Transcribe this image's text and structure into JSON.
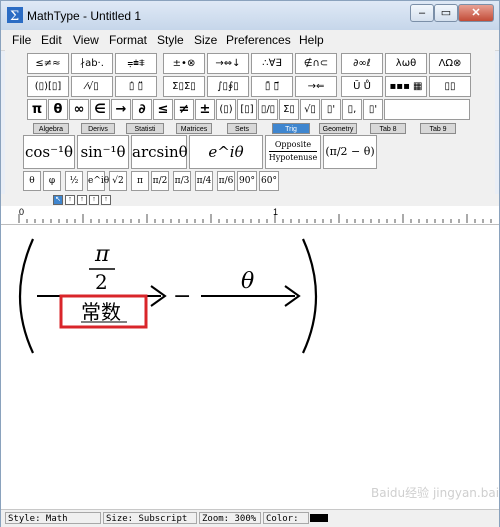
{
  "window": {
    "title": "MathType - Untitled 1",
    "min": "–",
    "max": "▭",
    "close": "✕"
  },
  "menu": [
    "File",
    "Edit",
    "View",
    "Format",
    "Style",
    "Size",
    "Preferences",
    "Help"
  ],
  "palette_row1": [
    "≤≠≈",
    "∤ab·.",
    "⩦⩧⩨",
    "±•⊗",
    "→⇔↓",
    "∴∀∃",
    "∉∩⊂",
    "∂∞ℓ",
    "λωθ",
    "ΛΩ⊗"
  ],
  "palette_row2": [
    "(▯)[▯]",
    "⁄√▯",
    "▯̇ ▯̈",
    "Σ▯Σ▯",
    "∫▯∮▯",
    "▯̄ ▯⃗",
    "→⇐",
    "Ū Ů",
    "▪▪▪ ▦",
    "▯▯"
  ],
  "palette_row3": [
    "π",
    "θ",
    "∞",
    "∈",
    "→",
    "∂",
    "≤",
    "≠",
    "±",
    "(▯)",
    "[▯]",
    "▯/▯",
    "Σ▯",
    "√▯",
    "▯'",
    "▯,",
    "▯'"
  ],
  "tabs": [
    "Algebra",
    "Derivs",
    "Statisti",
    "Matrices",
    "Sets",
    "Trig",
    "Geometry",
    "Tab 8",
    "Tab 9"
  ],
  "active_tab": "Trig",
  "templates": {
    "cos": "cos⁻¹θ",
    "sin": "sin⁻¹θ",
    "arcsin": "arcsinθ",
    "exp": "e^iθ",
    "opposite": "Opposite",
    "hypotenuse": "Hypotenuse",
    "paren": "(π/2 − θ)"
  },
  "small_symbols": [
    "θ",
    "φ",
    "½",
    "e^iθ",
    "√2",
    "π",
    "π/2",
    "π/3",
    "π/4",
    "π/6",
    "90°",
    "60°"
  ],
  "ruler_numbers": [
    "0",
    "1"
  ],
  "equation": {
    "numerator": "π",
    "denominator": "2",
    "annotation": "常数",
    "minus": "−",
    "theta": "θ"
  },
  "status": {
    "style": "Style: Math",
    "size": "Size: Subscript",
    "zoom": "Zoom: 300%",
    "color": "Color:"
  },
  "watermark": "Baidu经验 jingyan.baidu.com",
  "colors": {
    "highlight_box": "#d9252a",
    "active_tab": "#3f86cf"
  }
}
